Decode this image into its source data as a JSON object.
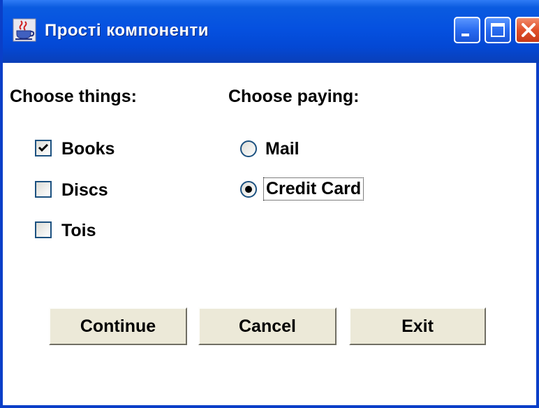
{
  "window": {
    "title": "Прості компоненти",
    "app_icon": "java-cup-icon",
    "controls": [
      "minimize-icon",
      "maximize-icon",
      "close-icon"
    ],
    "colors": {
      "titlebar": "#0551e0",
      "border": "#0a3fc8",
      "close": "#e0502a",
      "button_face": "#ece9d8"
    }
  },
  "things": {
    "heading": "Choose things:",
    "options": [
      {
        "label": "Books",
        "checked": true
      },
      {
        "label": "Discs",
        "checked": false
      },
      {
        "label": "Tois",
        "checked": false
      }
    ]
  },
  "paying": {
    "heading": "Choose paying:",
    "options": [
      {
        "label": "Mail",
        "selected": false
      },
      {
        "label": "Credit Card",
        "selected": true
      }
    ]
  },
  "buttons": {
    "continue": "Continue",
    "cancel": "Cancel",
    "exit": "Exit"
  }
}
